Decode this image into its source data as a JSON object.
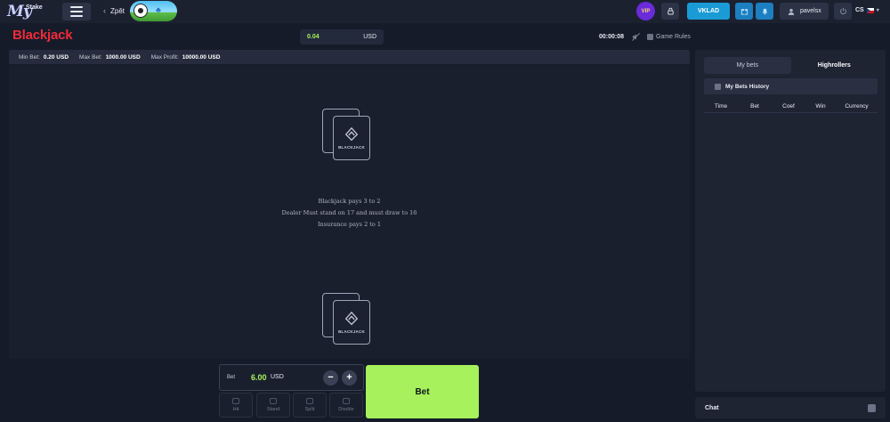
{
  "header": {
    "logo_my": "My",
    "logo_stake": "Stake",
    "back_label": "Zpět",
    "vip_label": "VIP",
    "deposit_label": "VKLAD",
    "username": "pavelsx",
    "language": "CS"
  },
  "game": {
    "title": "Blackjack",
    "balance_amount": "0.04",
    "balance_currency": "USD",
    "timer": "00:00:08",
    "rules_label": "Game Rules",
    "limits": {
      "min_label": "Min Bet:",
      "min_value": "0.20 USD",
      "max_label": "Max Bet:",
      "max_value": "1000.00 USD",
      "profit_label": "Max Profit:",
      "profit_value": "10000.00 USD"
    },
    "card_brand": "BLACKJACK",
    "rule_lines": [
      "Blackjack pays 3 to 2",
      "Dealer Must stand on 17 and must draw to 16",
      "Insurance pays 2 to 1"
    ]
  },
  "bet": {
    "label": "Bet",
    "amount": "6.00",
    "currency": "USD",
    "minus": "−",
    "plus": "+",
    "bet_button": "Bet",
    "actions": [
      "Hit",
      "Stand",
      "Split",
      "Double"
    ]
  },
  "side": {
    "tabs": [
      "My bets",
      "Highrollers"
    ],
    "history_title": "My Bets History",
    "columns": [
      "Time",
      "Bet",
      "Coef",
      "Win",
      "Currency"
    ],
    "chat_label": "Chat"
  },
  "colors": {
    "accent_green": "#a6f15c",
    "title_red": "#ee2b3a",
    "deposit_blue": "#1a9bd6"
  }
}
